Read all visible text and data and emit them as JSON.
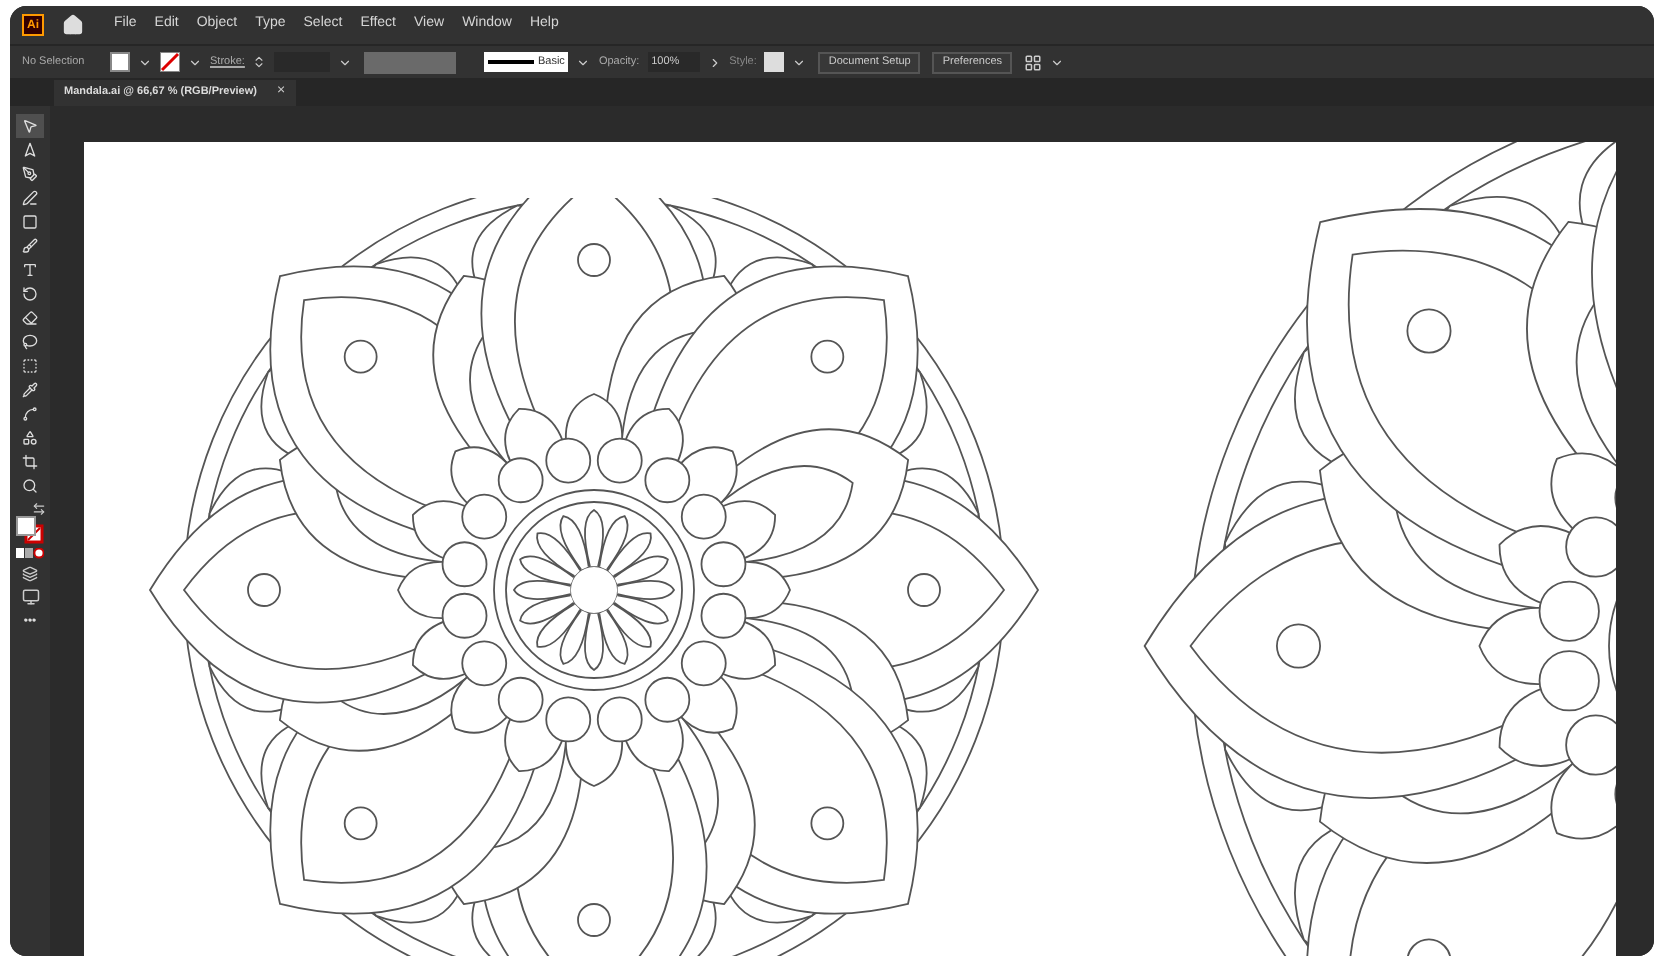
{
  "app": {
    "logo": "Ai"
  },
  "menu": [
    "File",
    "Edit",
    "Object",
    "Type",
    "Select",
    "Effect",
    "View",
    "Window",
    "Help"
  ],
  "control_bar": {
    "selection": "No Selection",
    "stroke_label": "Stroke:",
    "brush": "Basic",
    "opacity_label": "Opacity:",
    "opacity": "100%",
    "style_label": "Style:",
    "buttons": [
      "Document Setup",
      "Preferences"
    ]
  },
  "document_tab": {
    "title": "Mandala.ai @ 66,67 % (RGB/Preview)",
    "close": "×"
  },
  "tools": [
    {
      "kind": "selection",
      "selected": true
    },
    {
      "kind": "direct",
      "selected": false
    },
    {
      "kind": "pen",
      "selected": false
    },
    {
      "kind": "curvature",
      "selected": false
    },
    {
      "kind": "rectangle",
      "selected": false
    },
    {
      "kind": "brush",
      "selected": false
    },
    {
      "kind": "type",
      "selected": false
    },
    {
      "kind": "rotate",
      "selected": false
    },
    {
      "kind": "eraser",
      "selected": false
    },
    {
      "kind": "lasso",
      "selected": false
    },
    {
      "kind": "gradient",
      "selected": false
    },
    {
      "kind": "eyedropper",
      "selected": false
    },
    {
      "kind": "blend",
      "selected": false
    },
    {
      "kind": "shapebuilder",
      "selected": false
    },
    {
      "kind": "artboard",
      "selected": false
    },
    {
      "kind": "zoom",
      "selected": false
    }
  ],
  "more_tools": "•••"
}
